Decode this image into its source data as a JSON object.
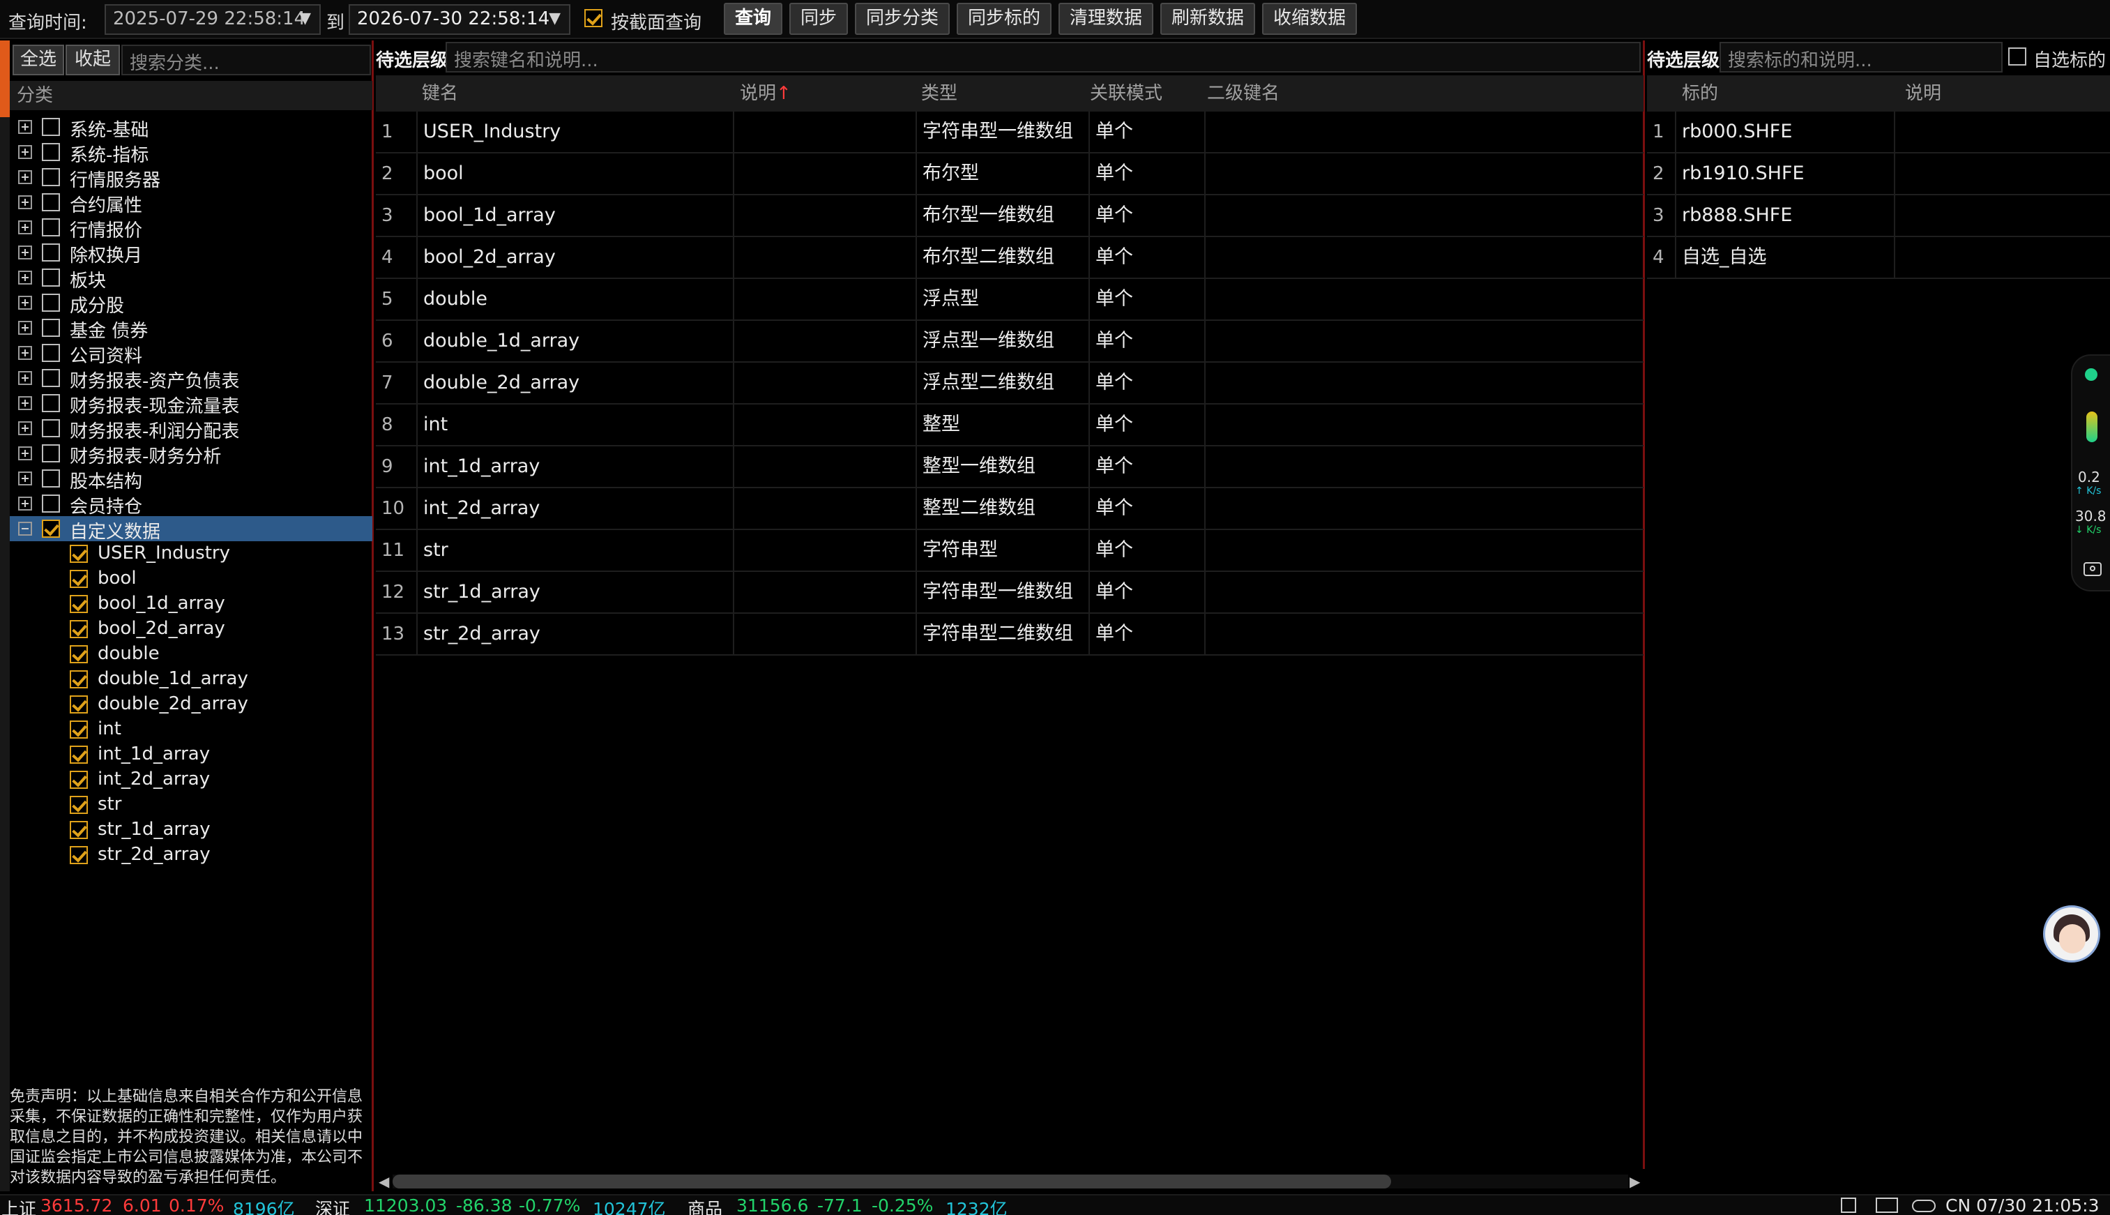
{
  "toolbar": {
    "query_time_label": "查询时间:",
    "start_time": "2025-07-29 22:58:14",
    "to_label": "到",
    "end_time": "2026-07-30 22:58:14",
    "by_section_label": "按截面查询",
    "buttons": [
      "查询",
      "同步",
      "同步分类",
      "同步标的",
      "清理数据",
      "刷新数据",
      "收缩数据"
    ]
  },
  "left": {
    "select_all": "全选",
    "collapse": "收起",
    "search_placeholder": "搜索分类...",
    "header": "分类",
    "categories": [
      "系统-基础",
      "系统-指标",
      "行情服务器",
      "合约属性",
      "行情报价",
      "除权换月",
      "板块",
      "成分股",
      "基金 债券",
      "公司资料",
      "财务报表-资产负债表",
      "财务报表-现金流量表",
      "财务报表-利润分配表",
      "财务报表-财务分析",
      "股本结构",
      "会员持仓"
    ],
    "expanded_category": "自定义数据",
    "children": [
      "USER_Industry",
      "bool",
      "bool_1d_array",
      "bool_2d_array",
      "double",
      "double_1d_array",
      "double_2d_array",
      "int",
      "int_1d_array",
      "int_2d_array",
      "str",
      "str_1d_array",
      "str_2d_array"
    ],
    "disclaimer": "免责声明：以上基础信息来自相关合作方和公开信息采集，不保证数据的正确性和完整性，仅作为用户获取信息之目的，并不构成投资建议。相关信息请以中国证监会指定上市公司信息披露媒体为准，本公司不对该数据内容导致的盈亏承担任何责任。"
  },
  "middle": {
    "level_label": "待选层级",
    "search_placeholder": "搜索键名和说明...",
    "columns": {
      "key": "键名",
      "desc": "说明",
      "sort_icon": "↑",
      "type": "类型",
      "mode": "关联模式",
      "subkey": "二级键名"
    },
    "rows": [
      {
        "n": "1",
        "key": "USER_Industry",
        "type": "字符串型一维数组",
        "mode": "单个"
      },
      {
        "n": "2",
        "key": "bool",
        "type": "布尔型",
        "mode": "单个"
      },
      {
        "n": "3",
        "key": "bool_1d_array",
        "type": "布尔型一维数组",
        "mode": "单个"
      },
      {
        "n": "4",
        "key": "bool_2d_array",
        "type": "布尔型二维数组",
        "mode": "单个"
      },
      {
        "n": "5",
        "key": "double",
        "type": "浮点型",
        "mode": "单个"
      },
      {
        "n": "6",
        "key": "double_1d_array",
        "type": "浮点型一维数组",
        "mode": "单个"
      },
      {
        "n": "7",
        "key": "double_2d_array",
        "type": "浮点型二维数组",
        "mode": "单个"
      },
      {
        "n": "8",
        "key": "int",
        "type": "整型",
        "mode": "单个"
      },
      {
        "n": "9",
        "key": "int_1d_array",
        "type": "整型一维数组",
        "mode": "单个"
      },
      {
        "n": "10",
        "key": "int_2d_array",
        "type": "整型二维数组",
        "mode": "单个"
      },
      {
        "n": "11",
        "key": "str",
        "type": "字符串型",
        "mode": "单个"
      },
      {
        "n": "12",
        "key": "str_1d_array",
        "type": "字符串型一维数组",
        "mode": "单个"
      },
      {
        "n": "13",
        "key": "str_2d_array",
        "type": "字符串型二维数组",
        "mode": "单个"
      }
    ]
  },
  "right": {
    "level_label": "待选层级",
    "search_placeholder": "搜索标的和说明...",
    "watchlist_label": "自选标的",
    "columns": {
      "symbol": "标的",
      "desc": "说明"
    },
    "rows": [
      {
        "n": "1",
        "symbol": "rb000.SHFE"
      },
      {
        "n": "2",
        "symbol": "rb1910.SHFE"
      },
      {
        "n": "3",
        "symbol": "rb888.SHFE"
      },
      {
        "n": "4",
        "symbol": "自选_自选"
      }
    ]
  },
  "side_widget": {
    "up_speed": "0.2",
    "up_unit": "K/s",
    "down_speed": "30.8",
    "down_unit": "K/s"
  },
  "status": {
    "sh_label": "上证",
    "sh_value": "3615.72",
    "sh_change": "6.01",
    "sh_pct": "0.17%",
    "sh_amount": "8196亿",
    "sz_label": "深证",
    "sz_value": "11203.03",
    "sz_change": "-86.38",
    "sz_pct": "-0.77%",
    "sz_amount": "10247亿",
    "cm_label": "商品",
    "cm_value": "31156.6",
    "cm_change": "-77.1",
    "cm_pct": "-0.25%",
    "cm_amount": "1232亿",
    "clock": "CN 07/30 21:05:3"
  },
  "colors": {
    "accent_border": "#7a0f0f",
    "checkbox": "#e0a21a",
    "selected_row": "#2d5a8a",
    "up": "#ff3b3b",
    "down": "#22d36a"
  }
}
